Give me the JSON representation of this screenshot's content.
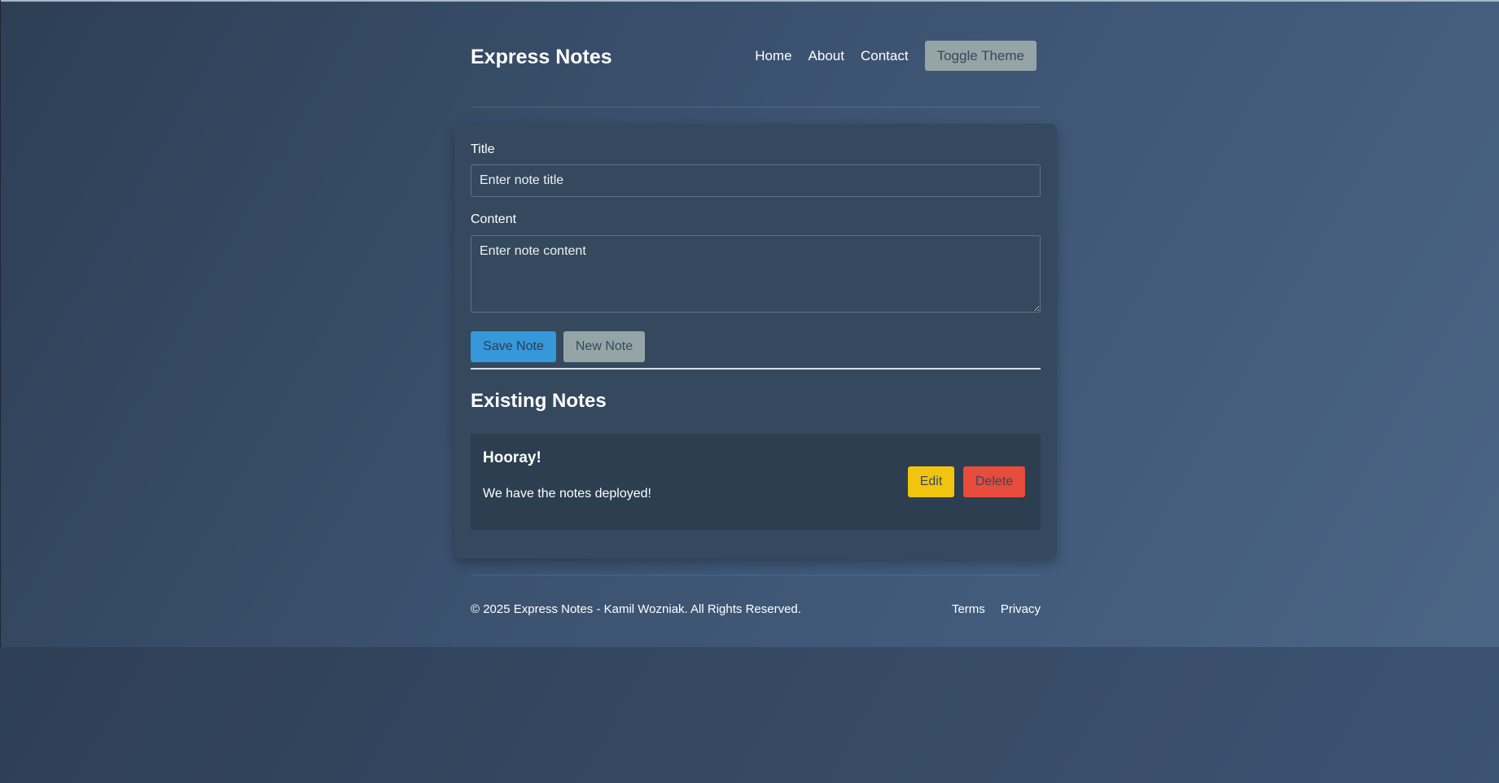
{
  "header": {
    "brand": "Express Notes",
    "nav": [
      "Home",
      "About",
      "Contact"
    ],
    "toggle_label": "Toggle Theme"
  },
  "form": {
    "title_label": "Title",
    "title_placeholder": "Enter note title",
    "content_label": "Content",
    "content_placeholder": "Enter note content",
    "save_label": "Save Note",
    "new_label": "New Note"
  },
  "notes_section": {
    "heading": "Existing Notes",
    "notes": [
      {
        "title": "Hooray!",
        "content": "We have the notes deployed!",
        "edit_label": "Edit",
        "delete_label": "Delete"
      }
    ]
  },
  "footer": {
    "copyright": "© 2025 Express Notes - Kamil Wozniak. All Rights Reserved.",
    "links": [
      "Terms",
      "Privacy"
    ]
  },
  "colors": {
    "primary": "#3498db",
    "secondary": "#95a5a6",
    "warning": "#f1c40f",
    "danger": "#e74c3c",
    "card": "#34495e",
    "note_bg": "#2c3e50"
  }
}
